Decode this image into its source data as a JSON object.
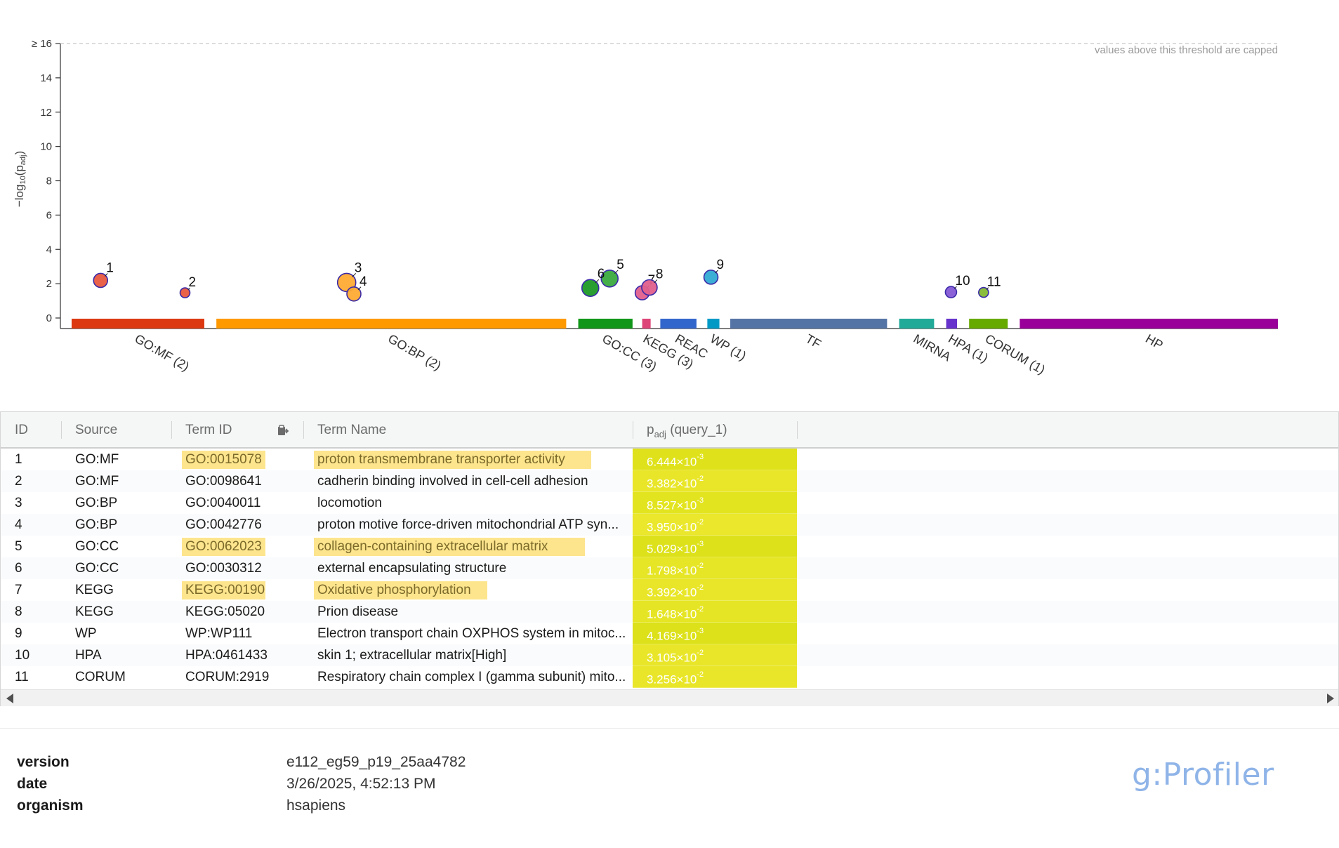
{
  "chart_data": {
    "type": "scatter",
    "ylabel": "−log₁₀(p_adj)",
    "ylim": [
      0,
      16
    ],
    "yticks": [
      "0",
      "2",
      "4",
      "6",
      "8",
      "10",
      "12",
      "14",
      "≥ 16"
    ],
    "cap_note": "values above this threshold are capped",
    "sources": [
      {
        "label": "GO:MF (2)",
        "color": "#dc3912",
        "start": 0.0,
        "end": 0.11
      },
      {
        "label": "GO:BP (2)",
        "color": "#ff9900",
        "start": 0.12,
        "end": 0.41
      },
      {
        "label": "GO:CC (3)",
        "color": "#109618",
        "start": 0.42,
        "end": 0.465
      },
      {
        "label": "KEGG (3)",
        "color": "#dd4477",
        "start": 0.473,
        "end": 0.48
      },
      {
        "label": "REAC",
        "color": "#3366cc",
        "start": 0.488,
        "end": 0.518
      },
      {
        "label": "WP (1)",
        "color": "#0099c6",
        "start": 0.527,
        "end": 0.537
      },
      {
        "label": "TF",
        "color": "#5574a6",
        "start": 0.546,
        "end": 0.676
      },
      {
        "label": "MIRNA",
        "color": "#22aa99",
        "start": 0.686,
        "end": 0.715
      },
      {
        "label": "HPA (1)",
        "color": "#6633cc",
        "start": 0.725,
        "end": 0.734
      },
      {
        "label": "CORUM (1)",
        "color": "#66aa00",
        "start": 0.744,
        "end": 0.776
      },
      {
        "label": "HP",
        "color": "#990099",
        "start": 0.786,
        "end": 1.0
      }
    ],
    "points": [
      {
        "id": "1",
        "x": 0.024,
        "y": 2.19,
        "r": 10,
        "color": "#e8593f"
      },
      {
        "id": "2",
        "x": 0.094,
        "y": 1.47,
        "r": 7,
        "color": "#e8593f"
      },
      {
        "id": "3",
        "x": 0.228,
        "y": 2.07,
        "r": 13,
        "color": "#ffab33"
      },
      {
        "id": "4",
        "x": 0.234,
        "y": 1.4,
        "r": 10,
        "color": "#ffab33"
      },
      {
        "id": "5",
        "x": 0.446,
        "y": 2.3,
        "r": 12,
        "color": "#3aaa3f"
      },
      {
        "id": "6",
        "x": 0.43,
        "y": 1.75,
        "r": 12,
        "color": "#1f9a26"
      },
      {
        "id": "7",
        "x": 0.473,
        "y": 1.47,
        "r": 10,
        "color": "#e0608d"
      },
      {
        "id": "8",
        "x": 0.479,
        "y": 1.78,
        "r": 11,
        "color": "#e0608d"
      },
      {
        "id": "9",
        "x": 0.53,
        "y": 2.38,
        "r": 10,
        "color": "#33aad3"
      },
      {
        "id": "10",
        "x": 0.729,
        "y": 1.51,
        "r": 8,
        "color": "#8559d6"
      },
      {
        "id": "11",
        "x": 0.756,
        "y": 1.49,
        "r": 7,
        "color": "#85bb33"
      }
    ]
  },
  "table": {
    "headers": {
      "id": "ID",
      "source": "Source",
      "term_id": "Term ID",
      "term_name": "Term Name",
      "padj_main": "p",
      "padj_sub": "adj",
      "padj_query": " (query_1)"
    },
    "rows": [
      {
        "id": "1",
        "source": "GO:MF",
        "term_id": "GO:0015078",
        "term_name": "proton transmembrane transporter activity",
        "p_mant": "6.444×10",
        "p_exp": "-3",
        "highlight": true,
        "color": "#dfe21a"
      },
      {
        "id": "2",
        "source": "GO:MF",
        "term_id": "GO:0098641",
        "term_name": "cadherin binding involved in cell-cell adhesion",
        "p_mant": "3.382×10",
        "p_exp": "-2",
        "highlight": false,
        "color": "#e9e62a"
      },
      {
        "id": "3",
        "source": "GO:BP",
        "term_id": "GO:0040011",
        "term_name": "locomotion",
        "p_mant": "8.527×10",
        "p_exp": "-3",
        "highlight": false,
        "color": "#e3e420"
      },
      {
        "id": "4",
        "source": "GO:BP",
        "term_id": "GO:0042776",
        "term_name": "proton motive force-driven mitochondrial ATP syn...",
        "p_mant": "3.950×10",
        "p_exp": "-2",
        "highlight": false,
        "color": "#eae72c"
      },
      {
        "id": "5",
        "source": "GO:CC",
        "term_id": "GO:0062023",
        "term_name": "collagen-containing extracellular matrix",
        "p_mant": "5.029×10",
        "p_exp": "-3",
        "highlight": true,
        "color": "#dde11a"
      },
      {
        "id": "6",
        "source": "GO:CC",
        "term_id": "GO:0030312",
        "term_name": "external encapsulating structure",
        "p_mant": "1.798×10",
        "p_exp": "-2",
        "highlight": false,
        "color": "#e6e526"
      },
      {
        "id": "7",
        "source": "KEGG",
        "term_id": "KEGG:00190",
        "term_name": "Oxidative phosphorylation",
        "p_mant": "3.392×10",
        "p_exp": "-2",
        "highlight": true,
        "color": "#e9e62a"
      },
      {
        "id": "8",
        "source": "KEGG",
        "term_id": "KEGG:05020",
        "term_name": "Prion disease",
        "p_mant": "1.648×10",
        "p_exp": "-2",
        "highlight": false,
        "color": "#e6e525"
      },
      {
        "id": "9",
        "source": "WP",
        "term_id": "WP:WP111",
        "term_name": "Electron transport chain OXPHOS system in mitoc...",
        "p_mant": "4.169×10",
        "p_exp": "-3",
        "highlight": false,
        "color": "#dce11a"
      },
      {
        "id": "10",
        "source": "HPA",
        "term_id": "HPA:0461433",
        "term_name": "skin 1; extracellular matrix[High]",
        "p_mant": "3.105×10",
        "p_exp": "-2",
        "highlight": false,
        "color": "#e9e62a"
      },
      {
        "id": "11",
        "source": "CORUM",
        "term_id": "CORUM:2919",
        "term_name": "Respiratory chain complex I (gamma subunit) mito...",
        "p_mant": "3.256×10",
        "p_exp": "-2",
        "highlight": false,
        "color": "#e9e62a"
      }
    ]
  },
  "meta": {
    "version_label": "version",
    "version_value": "e112_eg59_p19_25aa4782",
    "date_label": "date",
    "date_value": "3/26/2025, 4:52:13 PM",
    "organism_label": "organism",
    "organism_value": "hsapiens"
  },
  "brand": "g:Profiler",
  "icons": {
    "copy": "clipboard-copy-icon",
    "scroll_left": "arrow-left-icon",
    "scroll_right": "arrow-right-icon"
  }
}
